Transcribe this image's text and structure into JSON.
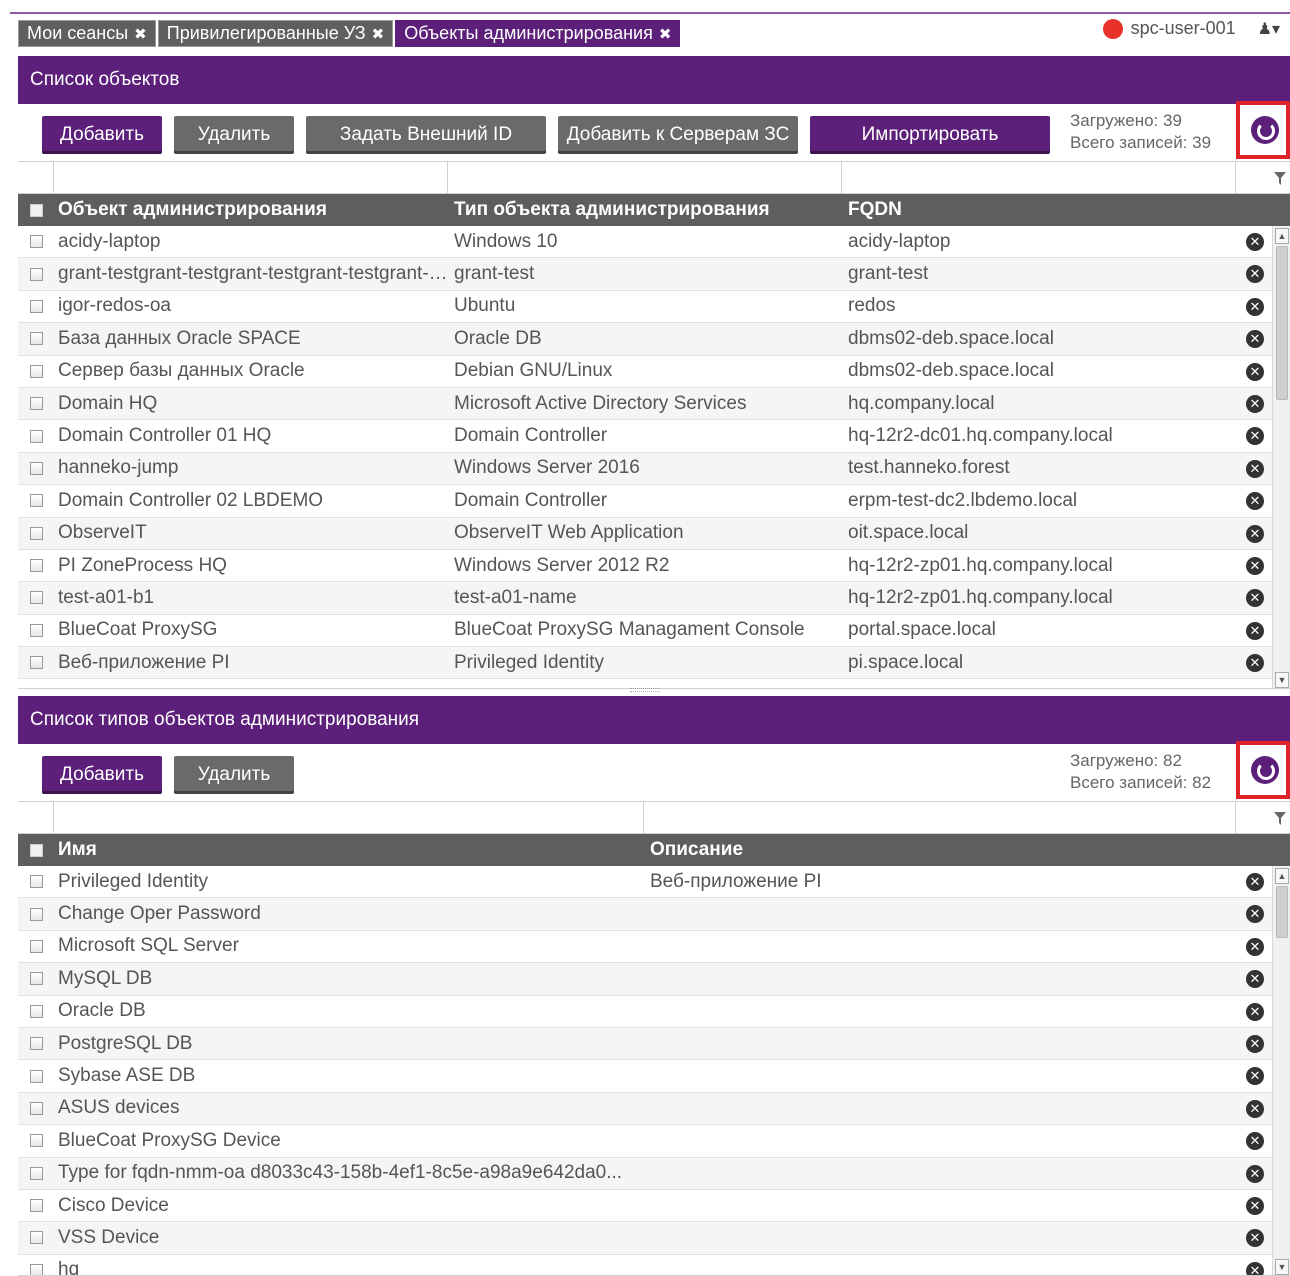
{
  "tabs": [
    {
      "label": "Мои сеансы",
      "active": false
    },
    {
      "label": "Привилегированные УЗ",
      "active": false
    },
    {
      "label": "Объекты администрирования",
      "active": true
    }
  ],
  "user": {
    "name": "spc-user-001",
    "status_color": "#e8312a"
  },
  "panel1": {
    "title": "Список объектов",
    "buttons": {
      "add": "Добавить",
      "delete": "Удалить",
      "set_ext_id": "Задать Внешний ID",
      "add_to_servers": "Добавить к Серверам ЗС",
      "import": "Импортировать"
    },
    "loaded": "Загружено: 39",
    "total": "Всего записей: 39",
    "columns": [
      "Объект администрирования",
      "Тип объекта администрирования",
      "FQDN"
    ],
    "rows": [
      [
        "acidy-laptop",
        "Windows 10",
        "acidy-laptop"
      ],
      [
        "grant-testgrant-testgrant-testgrant-testgrant-testgrant-test",
        "grant-test",
        "grant-test"
      ],
      [
        "igor-redos-oa",
        "Ubuntu",
        "redos"
      ],
      [
        "База данных Oracle SPACE",
        "Oracle DB",
        "dbms02-deb.space.local"
      ],
      [
        "Сервер базы данных Oracle",
        "Debian GNU/Linux",
        "dbms02-deb.space.local"
      ],
      [
        "Domain HQ",
        "Microsoft Active Directory Services",
        "hq.company.local"
      ],
      [
        "Domain Controller 01 HQ",
        "Domain Controller",
        "hq-12r2-dc01.hq.company.local"
      ],
      [
        "hanneko-jump",
        "Windows Server 2016",
        "test.hanneko.forest"
      ],
      [
        "Domain Controller 02 LBDEMO",
        "Domain Controller",
        "erpm-test-dc2.lbdemo.local"
      ],
      [
        "ObserveIT",
        "ObserveIT Web Application",
        "oit.space.local"
      ],
      [
        "PI ZoneProcess HQ",
        "Windows Server 2012 R2",
        "hq-12r2-zp01.hq.company.local"
      ],
      [
        "test-a01-b1",
        "test-a01-name",
        "hq-12r2-zp01.hq.company.local"
      ],
      [
        "BlueCoat ProxySG",
        "BlueCoat ProxySG Managament Console",
        "portal.space.local"
      ],
      [
        "Веб-приложение PI",
        "Privileged Identity",
        "pi.space.local"
      ]
    ]
  },
  "panel2": {
    "title": "Список типов объектов администрирования",
    "buttons": {
      "add": "Добавить",
      "delete": "Удалить"
    },
    "loaded": "Загружено: 82",
    "total": "Всего записей: 82",
    "columns": [
      "Имя",
      "Описание"
    ],
    "rows": [
      [
        "Privileged Identity",
        "Веб-приложение PI"
      ],
      [
        "Change Oper Password",
        ""
      ],
      [
        "Microsoft SQL Server",
        ""
      ],
      [
        "MySQL DB",
        ""
      ],
      [
        "Oracle DB",
        ""
      ],
      [
        "PostgreSQL DB",
        ""
      ],
      [
        "Sybase ASE DB",
        ""
      ],
      [
        "ASUS devices",
        ""
      ],
      [
        "BlueCoat ProxySG Device",
        ""
      ],
      [
        "Type for fqdn-nmm-oa d8033c43-158b-4ef1-8c5e-a98a9e642da0...",
        ""
      ],
      [
        "Cisco Device",
        ""
      ],
      [
        "VSS Device",
        ""
      ],
      [
        "hq",
        ""
      ]
    ]
  },
  "colors": {
    "accent": "#5c1f7a",
    "highlight": "#e0232a",
    "header_grey": "#5e5e5e"
  }
}
